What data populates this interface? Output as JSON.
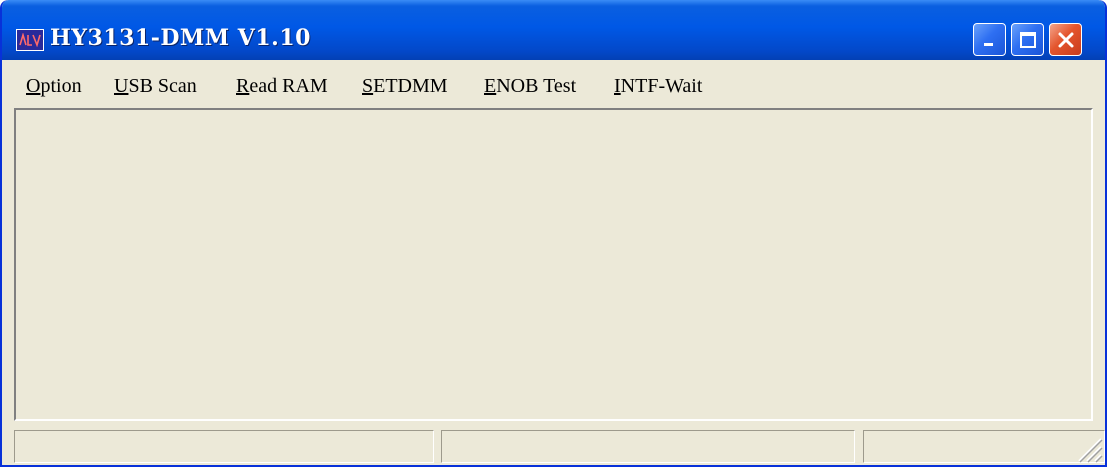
{
  "window": {
    "title": "HY3131-DMM V1.10",
    "icon": "app-logo-icon",
    "controls": {
      "minimize_icon": "minimize-icon",
      "maximize_icon": "maximize-icon",
      "close_icon": "close-icon"
    }
  },
  "menu": {
    "items": [
      {
        "mnemonic": "O",
        "rest": "ption"
      },
      {
        "mnemonic": "U",
        "rest": "SB Scan"
      },
      {
        "mnemonic": "R",
        "rest": "ead RAM"
      },
      {
        "mnemonic": "S",
        "rest": "ETDMM"
      },
      {
        "mnemonic": "E",
        "rest": "NOB Test"
      },
      {
        "mnemonic": "I",
        "rest": "NTF-Wait"
      }
    ]
  },
  "statusbar": {
    "panels": [
      "",
      "",
      ""
    ],
    "grip_icon": "resize-grip-icon"
  },
  "colors": {
    "titlebar": "#0058e6",
    "close_button": "#e4552d",
    "face": "#ece9d8"
  }
}
